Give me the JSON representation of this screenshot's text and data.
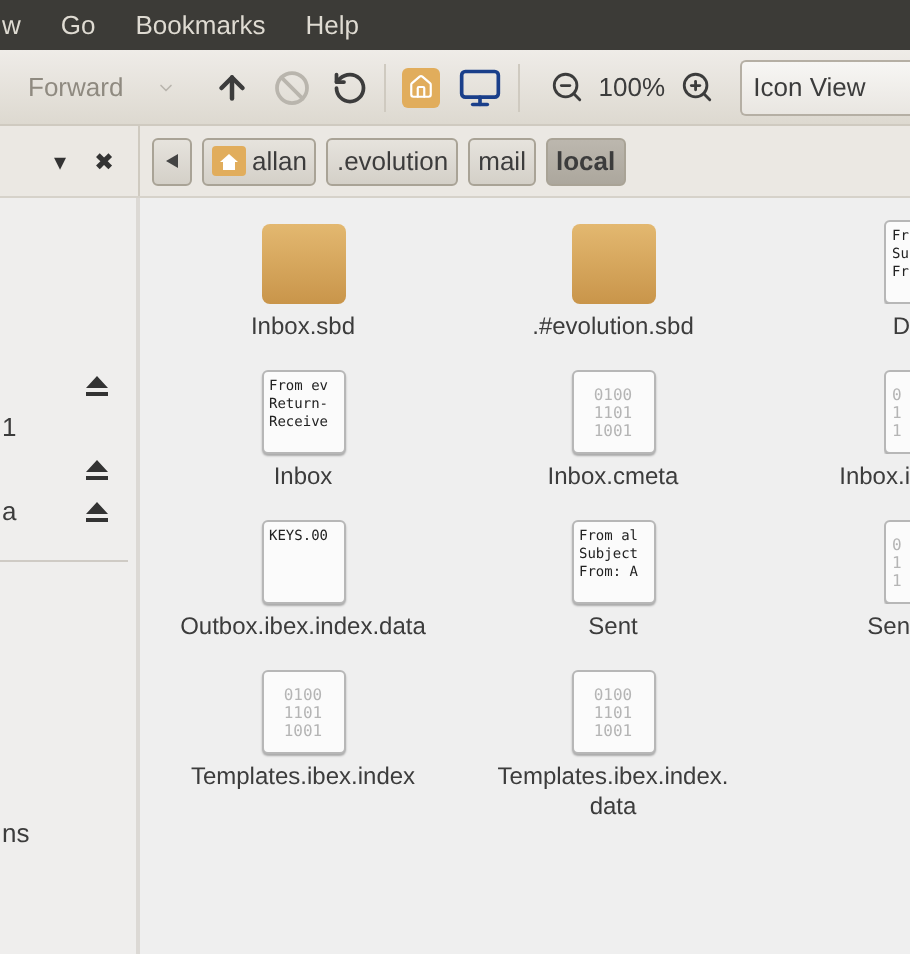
{
  "menu": [
    "w",
    "Go",
    "Bookmarks",
    "Help"
  ],
  "toolbar": {
    "forward": {
      "label": "Forward",
      "disabled": true
    },
    "stop": {
      "disabled": true
    },
    "zoom": "100%",
    "view": "Icon View"
  },
  "sidebar_header": {
    "menu": "▾",
    "close": "✖"
  },
  "crumbs": [
    {
      "label": "allan",
      "kind": "home",
      "selected": false
    },
    {
      "label": ".evolution",
      "kind": "plain",
      "selected": false
    },
    {
      "label": "mail",
      "kind": "plain",
      "selected": false
    },
    {
      "label": "local",
      "kind": "plain",
      "selected": true
    }
  ],
  "sidebar": {
    "items": [
      {
        "ejectable": true
      },
      {
        "label": "1",
        "ejectable": false
      },
      {
        "ejectable": true
      },
      {
        "label": "a",
        "ejectable": true
      }
    ],
    "bottom_items": [
      {
        "label": "ns"
      }
    ]
  },
  "files": [
    {
      "name": "Inbox.sbd",
      "kind": "folder"
    },
    {
      "name": ".#evolution.sbd",
      "kind": "folder"
    },
    {
      "name": "D",
      "kind": "text",
      "preview": [
        "Fr",
        "Su",
        "Fr"
      ]
    },
    {
      "name": "Inbox",
      "kind": "text",
      "preview": [
        "From ev",
        "Return-",
        "Receive"
      ]
    },
    {
      "name": "Inbox.cmeta",
      "kind": "binary",
      "preview": [
        "0100",
        "1101",
        "1001"
      ]
    },
    {
      "name": "Inbox.i",
      "kind": "binary",
      "preview": [
        "0",
        "1",
        "1"
      ]
    },
    {
      "name": "Outbox.ibex.index.data",
      "kind": "text",
      "preview": [
        "KEYS.00"
      ]
    },
    {
      "name": "Sent",
      "kind": "text",
      "preview": [
        "From al",
        "Subject",
        "From: A"
      ]
    },
    {
      "name": "Sen",
      "kind": "binary",
      "preview": [
        "0",
        "1",
        "1"
      ]
    },
    {
      "name": "Templates.ibex.index",
      "kind": "binary",
      "preview": [
        "0100",
        "1101",
        "1001"
      ]
    },
    {
      "name": "Templates.ibex.index.data",
      "kind": "binary",
      "preview": [
        "0100",
        "1101",
        "1001"
      ]
    }
  ]
}
